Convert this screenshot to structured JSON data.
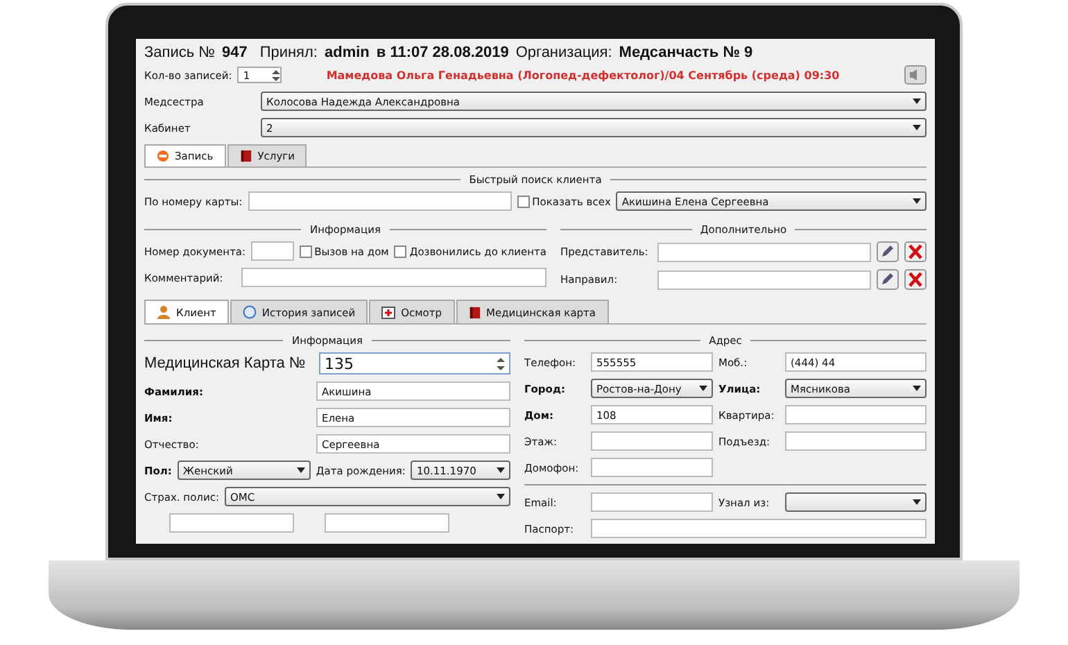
{
  "header": {
    "record_label": "Запись №",
    "record_number": "947",
    "accepted_label": "Принял:",
    "accepted_by": "admin",
    "accepted_at": "в 11:07 28.08.2019",
    "org_label": "Организация:",
    "org": "Медсанчасть № 9"
  },
  "count": {
    "label": "Кол-во записей:",
    "value": "1"
  },
  "appointment": "Мамедова Ольга Генадьевна (Логопед-дефектолог)/04 Сентябрь (среда) 09:30",
  "nurse": {
    "label": "Медсестра",
    "value": "Колосова Надежда Александровна"
  },
  "cabinet": {
    "label": "Кабинет",
    "value": "2"
  },
  "tabs": [
    {
      "label": "Запись",
      "selected": true,
      "kind": "record"
    },
    {
      "label": "Услуги",
      "selected": false,
      "kind": "book"
    }
  ],
  "quick_search": {
    "title": "Быстрый поиск клиента",
    "card_label": "По номеру карты:",
    "show_all": {
      "label": "Показать всех",
      "checked": false
    },
    "client": "Акишина Елена Сергеевна"
  },
  "info": {
    "title": "Информация",
    "doc_label": "Номер документа:",
    "home_call": {
      "label": "Вызов на дом",
      "checked": false
    },
    "called": {
      "label": "Дозвонились до клиента",
      "checked": false
    },
    "comment_label": "Комментарий:"
  },
  "extra": {
    "title": "Дополнительно",
    "rows": [
      {
        "label": "Представитель:"
      },
      {
        "label": "Направил:"
      }
    ]
  },
  "client_tabs": [
    {
      "label": "Клиент",
      "selected": true,
      "kind": "person"
    },
    {
      "label": "История записей",
      "selected": false,
      "kind": "clock"
    },
    {
      "label": "Осмотр",
      "selected": false,
      "kind": "kit"
    },
    {
      "label": "Медицинская карта",
      "selected": false,
      "kind": "book"
    }
  ],
  "client": {
    "title": "Информация",
    "card_label": "Медицинская Карта №",
    "card_number": "135",
    "fields": [
      {
        "label": "Фамилия:",
        "value": "Акишина",
        "bold": true
      },
      {
        "label": "Имя:",
        "value": "Елена",
        "bold": true
      },
      {
        "label": "Отчество:",
        "value": "Сергеевна",
        "bold": false
      }
    ],
    "gender": {
      "label": "Пол:",
      "value": "Женский"
    },
    "birth": {
      "label": "Дата рождения:",
      "value": "10.11.1970"
    },
    "insurance": {
      "label": "Страх. полис:",
      "value": "ОМС"
    }
  },
  "address": {
    "title": "Адрес",
    "fields": [
      {
        "label": "Телефон:",
        "value": "555555",
        "bold": false,
        "kind": "input"
      },
      {
        "label": "Моб.:",
        "value": "(444) 44",
        "bold": false,
        "kind": "input"
      },
      {
        "label": "Город:",
        "value": "Ростов-на-Дону",
        "bold": true,
        "kind": "select"
      },
      {
        "label": "Улица:",
        "value": "Мясникова",
        "bold": true,
        "kind": "select"
      },
      {
        "label": "Дом:",
        "value": "108",
        "bold": true,
        "kind": "input"
      },
      {
        "label": "Квартира:",
        "bold": false,
        "kind": "input"
      },
      {
        "label": "Этаж:",
        "bold": false,
        "kind": "input"
      },
      {
        "label": "Подъезд:",
        "bold": false,
        "kind": "input"
      },
      {
        "label": "Домофон:",
        "bold": false,
        "kind": "input"
      }
    ],
    "contact": [
      {
        "label": "Email:",
        "bold": false,
        "kind": "input"
      },
      {
        "label": "Узнал из:",
        "bold": false,
        "kind": "select"
      }
    ],
    "passport_label": "Паспорт:"
  }
}
